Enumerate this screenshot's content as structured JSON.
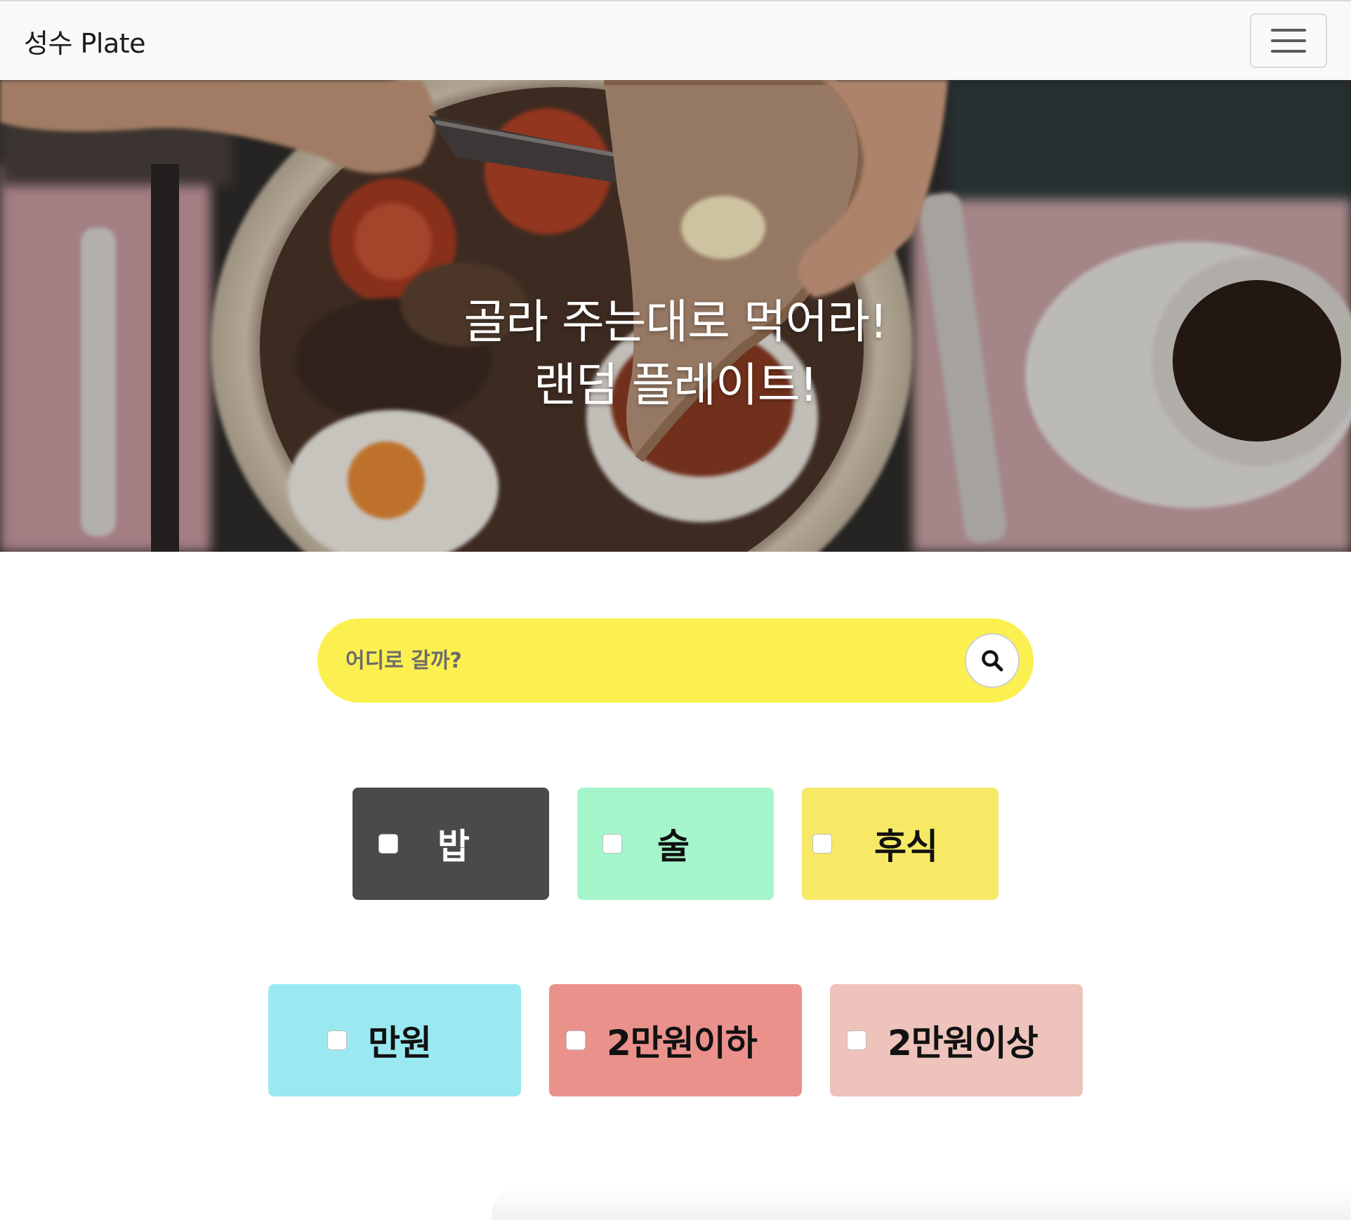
{
  "navbar": {
    "brand": "성수 Plate",
    "menu_icon": "hamburger-menu-icon"
  },
  "hero": {
    "line1": "골라 주는대로 먹어라!",
    "line2": "랜덤 플레이트!"
  },
  "search": {
    "placeholder": "어디로 갈까?",
    "icon": "search-icon",
    "bar_color": "#fcf050"
  },
  "categories": [
    {
      "label": "밥",
      "color": "#4a4a4a",
      "text_color": "#ffffff",
      "checked": false
    },
    {
      "label": "술",
      "color": "#a4f6ca",
      "text_color": "#111111",
      "checked": false
    },
    {
      "label": "후식",
      "color": "#f7e966",
      "text_color": "#111111",
      "checked": false
    }
  ],
  "prices": [
    {
      "label": "만원",
      "color": "#9be9f0",
      "text_color": "#111111",
      "checked": false
    },
    {
      "label": "2만원이하",
      "color": "#eb918c",
      "text_color": "#111111",
      "checked": false
    },
    {
      "label": "2만원이상",
      "color": "#edc3bb",
      "text_color": "#111111",
      "checked": false
    }
  ]
}
